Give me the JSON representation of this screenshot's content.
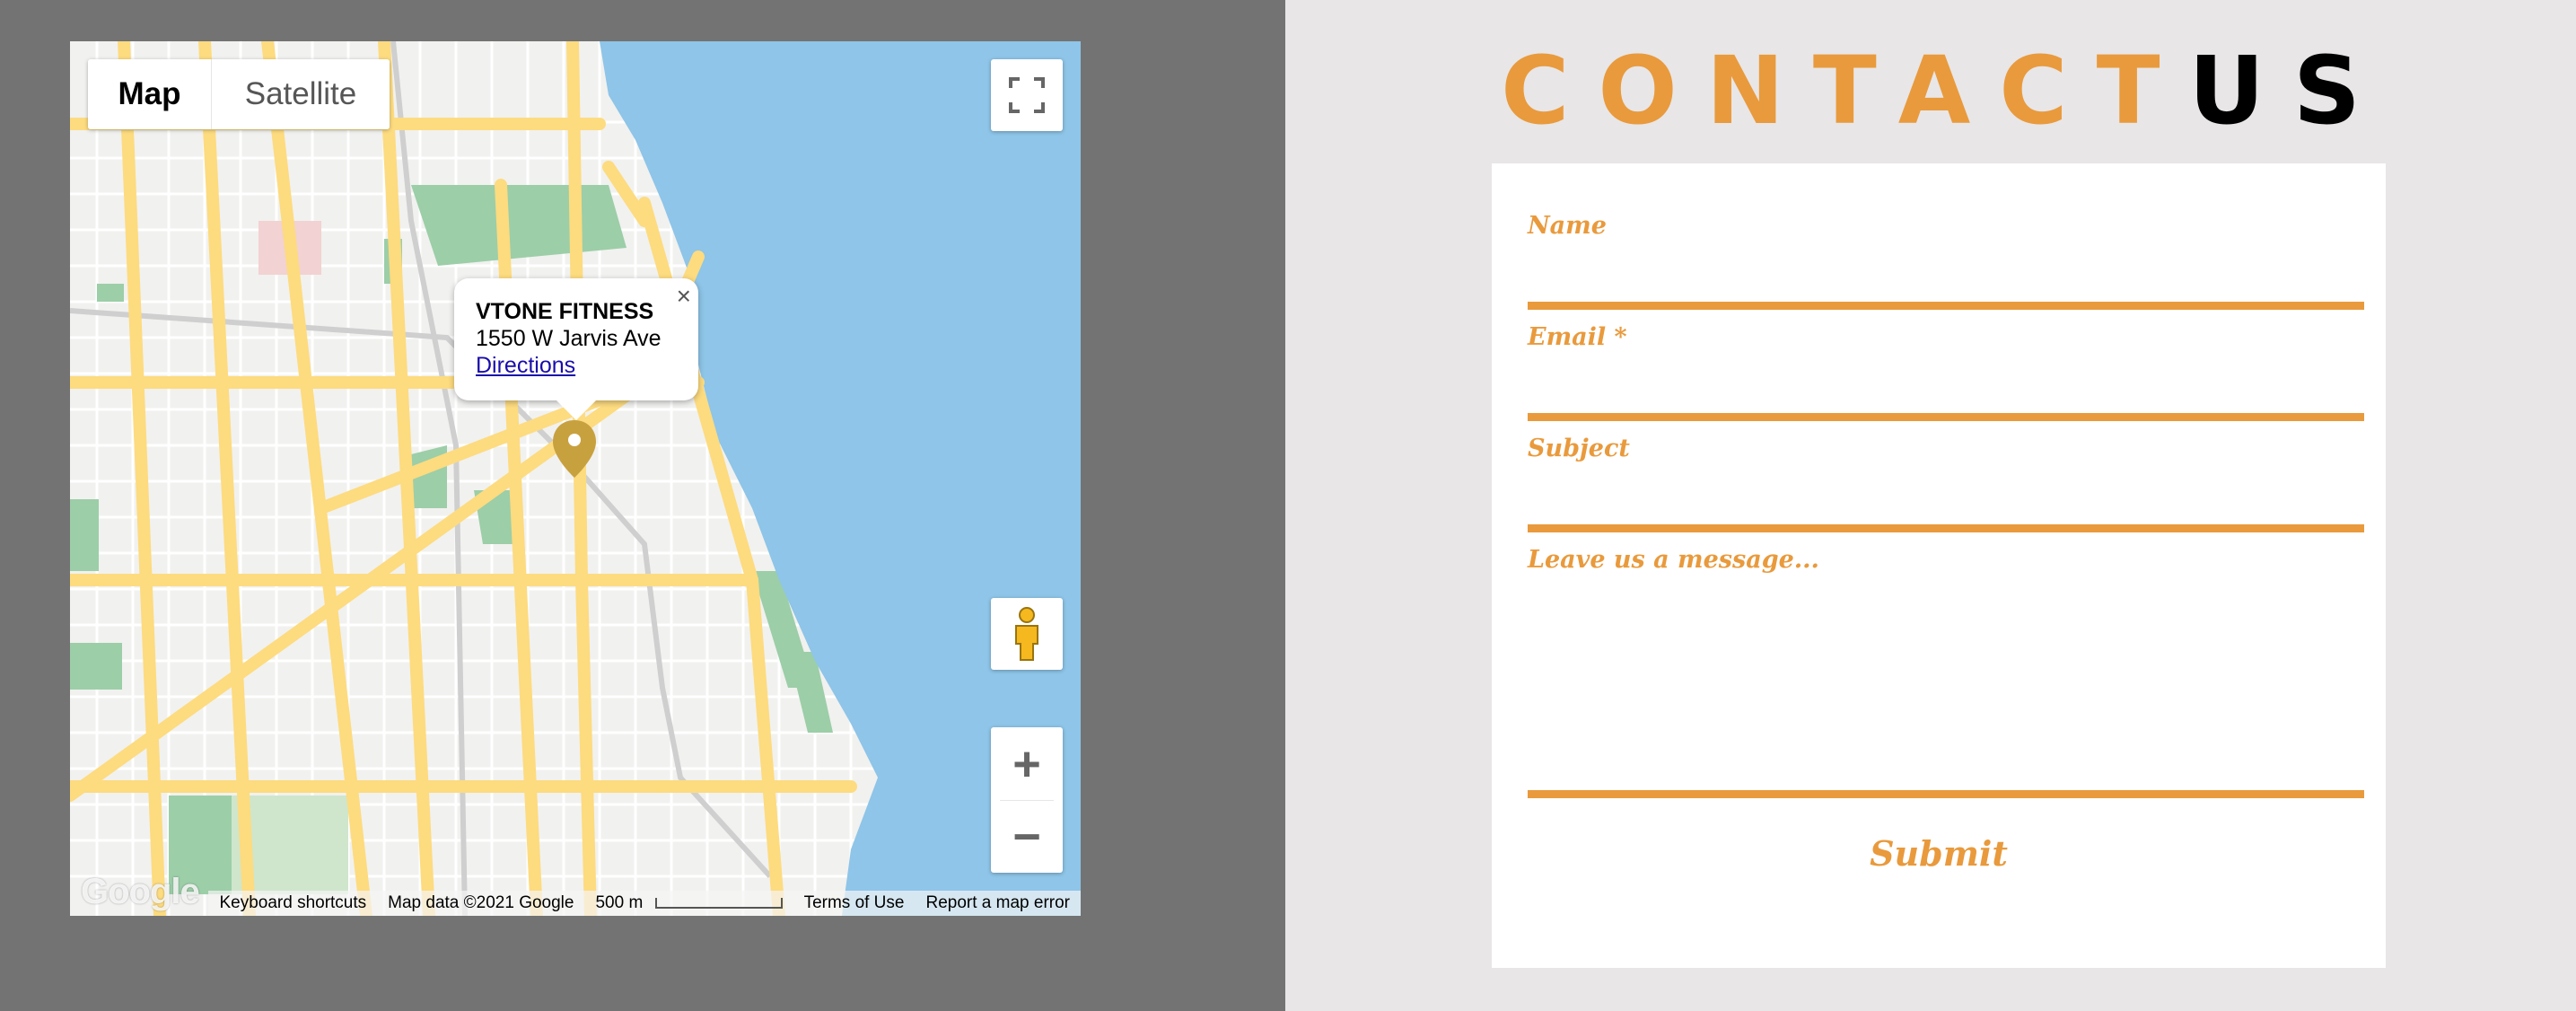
{
  "map": {
    "type_buttons": {
      "map_label": "Map",
      "satellite_label": "Satellite"
    },
    "info_window": {
      "title": "VTONE FITNESS",
      "address": "1550 W Jarvis Ave",
      "link_label": "Directions",
      "close_glyph": "×"
    },
    "zoom": {
      "in_glyph": "+",
      "out_glyph": "−"
    },
    "footer": {
      "keyboard_shortcuts": "Keyboard shortcuts",
      "map_data": "Map data ©2021 Google",
      "scale_label": "500 m",
      "terms": "Terms of Use",
      "report": "Report a map error"
    },
    "logo_text": "Google",
    "colors": {
      "water": "#8ec5e8",
      "road": "#fddb7f",
      "park": "#9ccea8",
      "pin": "#c8a13f"
    },
    "icons": [
      "fullscreen-icon",
      "pegman-icon",
      "map-pin-icon",
      "close-icon"
    ]
  },
  "contact": {
    "title_part1": "CONTACT",
    "title_part2": "US",
    "fields": {
      "name_label": "Name",
      "email_label": "Email *",
      "subject_label": "Subject",
      "message_label": "Leave us a message..."
    },
    "submit_label": "Submit",
    "accent_color": "#e99a3c"
  }
}
